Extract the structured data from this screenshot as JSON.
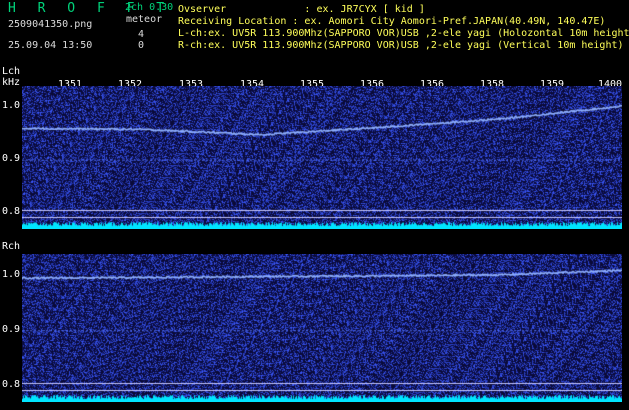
{
  "header": {
    "brand": "H R O F F T",
    "channels": "2ch 0.30",
    "meteor_label": "meteor",
    "filename": "2509041350.png",
    "timestamp": "25.09.04 13:50",
    "lch_meteor_count": "4",
    "rch_meteor_count": "0",
    "observer": "Ovserver             : ex. JR7CYX [ kid ]",
    "location": "Receiving Location : ex. Aomori City Aomori-Pref.JAPAN(40.49N, 140.47E)",
    "lch_info": "L-ch:ex. UV5R 113.900Mhz(SAPPORO VOR)USB ,2-ele yagi (Holozontal 10m height)",
    "rch_info": "R-ch:ex. UV5R 113.900Mhz(SAPPORO VOR)USB ,2-ele yagi (Vertical 10m height)"
  },
  "lch": {
    "label": "Lch",
    "unit": "kHz",
    "y_ticks": [
      "1.0",
      "0.9",
      "0.8"
    ]
  },
  "rch": {
    "label": "Rch",
    "y_ticks": [
      "1.0",
      "0.9",
      "0.8"
    ]
  },
  "time_ticks": [
    "1351",
    "1352",
    "1353",
    "1354",
    "1355",
    "1356",
    "1356",
    "1358",
    "1359",
    "1400"
  ],
  "colors": {
    "background": "#000000",
    "panel": "#0a0a38",
    "noise": "#2a3cff",
    "trace": "#8fb0ff",
    "guide": "#c8c8ff",
    "level": "#00e5ff",
    "brand": "#00d27a",
    "info": "#ffff5a"
  },
  "chart_data": {
    "type": "heatmap",
    "panels": [
      {
        "name": "Lch",
        "ylabel": "kHz",
        "ylim": [
          0.77,
          1.04
        ],
        "y_ticks": [
          1.0,
          0.9,
          0.8
        ],
        "carrier": {
          "t": [
            13.5,
            13.52,
            13.54,
            13.56,
            13.58,
            14.0
          ],
          "f": [
            0.96,
            0.958,
            0.948,
            0.962,
            0.978,
            1.002
          ]
        }
      },
      {
        "name": "Rch",
        "ylim": [
          0.77,
          1.04
        ],
        "y_ticks": [
          1.0,
          0.9,
          0.8
        ],
        "carrier": {
          "t": [
            13.5,
            13.52,
            13.54,
            13.56,
            13.58,
            14.0
          ],
          "f": [
            0.996,
            0.997,
            0.999,
            1.0,
            1.002,
            1.01
          ]
        }
      }
    ]
  }
}
